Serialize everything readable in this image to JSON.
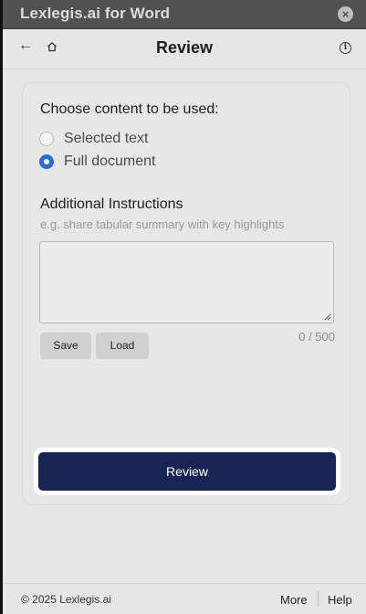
{
  "window": {
    "title": "Lexlegis.ai for Word",
    "close_icon": "×"
  },
  "header": {
    "back_icon": "←",
    "title": "Review",
    "info_icon": "i"
  },
  "content": {
    "section_title": "Choose content to be used:",
    "options": [
      {
        "label": "Selected text",
        "selected": false
      },
      {
        "label": "Full document",
        "selected": true
      }
    ],
    "instructions_title": "Additional Instructions",
    "instructions_placeholder": "e.g. share tabular summary with key highlights",
    "instructions_value": "",
    "save_label": "Save",
    "load_label": "Load",
    "char_counter": "0 / 500",
    "review_button": "Review"
  },
  "footer": {
    "copyright": "© 2025 Lexlegis.ai",
    "more": "More",
    "help": "Help"
  },
  "colors": {
    "accent": "#2f6bd6",
    "primary_button": "#172554"
  }
}
